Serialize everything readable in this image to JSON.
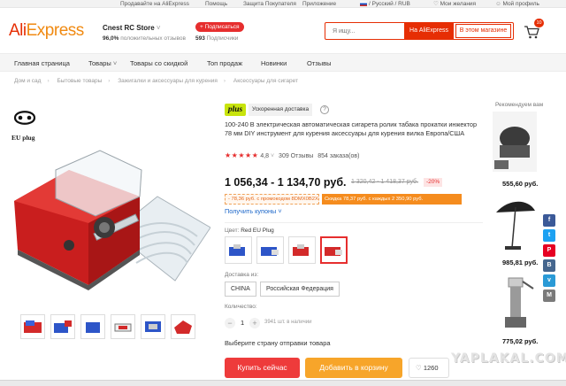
{
  "topbar": {
    "seller": "Продавайте на AliExpress",
    "help": "Помощь",
    "protection": "Защита Покупателя",
    "app": "Приложение",
    "locale": "/ Русский / RUB",
    "wishlist": "Мои желания",
    "profile": "Мой профиль"
  },
  "header": {
    "logo_main": "Ali",
    "logo_accent": "Express",
    "store_name": "Cnest RC Store",
    "store_rating_value": "96,0%",
    "store_rating_text": "положительных отзывов",
    "follow_label": "+ Подписаться",
    "subscribers_count": "593",
    "subscribers_text": "Подписчики",
    "search_placeholder": "Я ищу...",
    "search_everywhere": "На AliExpress",
    "search_store": "В этом магазине",
    "cart_count": "10"
  },
  "nav": {
    "items": [
      "Главная страница",
      "Товары",
      "Товары со скидкой",
      "Топ продаж",
      "Новинки",
      "Отзывы"
    ]
  },
  "breadcrumbs": [
    "Дом и сад",
    "Бытовые товары",
    "Зажигалки и аксессуары для курения",
    "Аксессуары для сигарет"
  ],
  "gallery": {
    "plug_label": "EU plug"
  },
  "product": {
    "plus_label": "plus",
    "fast_shipping": "Ускоренная доставка",
    "info": "?",
    "title": "100-240 В электрическая автоматическая сигарета ролик табака прокатки инжектор 78 мм DIY инструмент для курения аксессуары для курения вилка Европа/США",
    "rating": "4,8",
    "reviews": "309 Отзывы",
    "orders": "854 заказа(ов)",
    "price": "1 056,34 - 1 134,70 руб.",
    "old_price": "1 320,42 - 1 418,37 руб.",
    "discount": "-20%",
    "coupon_store": "- 78,36 руб. с промокодом 8DMX0B2XX342",
    "coupon_promo": "Скидка 78,37 руб. с каждых 2 350,90 руб.",
    "get_coupons": "Получить купоны",
    "color_label": "Цвет:",
    "color_value": "Red EU Plug",
    "shipping_label": "Доставка из:",
    "ship_from": [
      "CHINA",
      "Российская Федерация"
    ],
    "quantity_label": "Количество:",
    "quantity": "1",
    "qty_minus": "−",
    "qty_plus": "+",
    "stock": "3941 шт. в наличии",
    "choose_country": "Выберите страну отправки товара",
    "buy_now": "Купить сейчас",
    "add_to_cart": "Добавить в корзину",
    "wish_count": "1260"
  },
  "recommendations": {
    "title": "Рекомендуем вам",
    "prices": [
      "555,60 руб.",
      "985,81 руб.",
      "775,02 руб."
    ]
  },
  "share": [
    "f",
    "t",
    "P",
    "B",
    "v",
    "M"
  ],
  "watermark": "YAPLAKAL.COM",
  "colors": {
    "brand_red": "#e62e04",
    "brand_orange": "#f08a12",
    "buy_red": "#ee3b3b",
    "cart_orange": "#f7a52a"
  }
}
